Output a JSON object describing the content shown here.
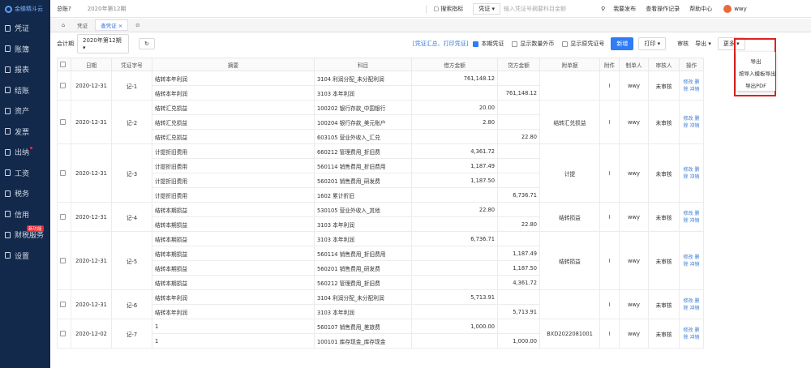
{
  "app": {
    "name": "金蝶精斗云"
  },
  "sidebar": {
    "items": [
      {
        "label": "凭证"
      },
      {
        "label": "账簿"
      },
      {
        "label": "报表"
      },
      {
        "label": "结账"
      },
      {
        "label": "资产"
      },
      {
        "label": "发票"
      },
      {
        "label": "出纳"
      },
      {
        "label": "工资"
      },
      {
        "label": "税务"
      },
      {
        "label": "信用"
      },
      {
        "label": "财税服务",
        "tag": "新功能"
      },
      {
        "label": "设置"
      }
    ]
  },
  "topbar": {
    "company": "总账?",
    "period": "2020年第12期",
    "search_label": "搜索指标",
    "type": "凭证",
    "search_placeholder": "输入凭证号摘要科目金额",
    "links": [
      "我要发布",
      "查看操作记录",
      "帮助中心"
    ],
    "user": "wwy"
  },
  "tabs": [
    "首页",
    "凭证",
    "查凭证"
  ],
  "toolbar": {
    "period_label": "会计期",
    "period_value": "2020年第12期",
    "summary_link": "[凭证汇总、打印凭证]",
    "check1": "本期凭证",
    "check2": "显示数量外币",
    "check3": "显示原凭证号",
    "add": "新增",
    "print": "打印",
    "more1": "审核",
    "export": "导出",
    "more": "更多"
  },
  "dropdown": [
    "导出",
    "按导入模板导出",
    "导出PDF"
  ],
  "headers": [
    "日期",
    "凭证字号",
    "摘要",
    "科目",
    "借方金额",
    "贷方金额",
    "附单据",
    "附件",
    "制单人",
    "审核人",
    "操作"
  ],
  "vouchers": [
    {
      "date": "2020-12-31",
      "no": "记-1",
      "attach": "",
      "maker": "wwy",
      "status": "未审核",
      "rows": [
        [
          "结转本年利润",
          "3104 利润分配_未分配利润",
          "761,148.12",
          ""
        ],
        [
          "结转本年利润",
          "3103 本年利润",
          "",
          "761,148.12"
        ]
      ]
    },
    {
      "date": "2020-12-31",
      "no": "记-2",
      "attach": "结转汇兑损益",
      "maker": "wwy",
      "status": "未审核",
      "rows": [
        [
          "结转汇兑损益",
          "100202 银行存款_中国银行",
          "20.00",
          ""
        ],
        [
          "结转汇兑损益",
          "100204 银行存款_美元账户",
          "2.80",
          ""
        ],
        [
          "结转汇兑损益",
          "603105 营业外收入_汇兑",
          "",
          "22.80"
        ]
      ]
    },
    {
      "date": "2020-12-31",
      "no": "记-3",
      "attach": "计提",
      "maker": "wwy",
      "status": "未审核",
      "rows": [
        [
          "计提折旧费用",
          "660212 管理费用_折旧费",
          "4,361.72",
          ""
        ],
        [
          "计提折旧费用",
          "560114 销售费用_折旧费用",
          "1,187.49",
          ""
        ],
        [
          "计提折旧费用",
          "560201 销售费用_研发费",
          "1,187.50",
          ""
        ],
        [
          "计提折旧费用",
          "1602 累计折旧",
          "",
          "6,736.71"
        ]
      ]
    },
    {
      "date": "2020-12-31",
      "no": "记-4",
      "attach": "结转损益",
      "maker": "wwy",
      "status": "未审核",
      "rows": [
        [
          "结转本期损益",
          "530105 营业外收入_其他",
          "22.80",
          ""
        ],
        [
          "结转本期损益",
          "3103 本年利润",
          "",
          "22.80"
        ]
      ]
    },
    {
      "date": "2020-12-31",
      "no": "记-5",
      "attach": "结转损益",
      "maker": "wwy",
      "status": "未审核",
      "rows": [
        [
          "结转本期损益",
          "3103 本年利润",
          "6,736.71",
          ""
        ],
        [
          "结转本期损益",
          "560114 销售费用_折旧费用",
          "",
          "1,187.49"
        ],
        [
          "结转本期损益",
          "560201 销售费用_研发费",
          "",
          "1,187.50"
        ],
        [
          "结转本期损益",
          "560212 管理费用_折旧费",
          "",
          "4,361.72"
        ]
      ]
    },
    {
      "date": "2020-12-31",
      "no": "记-6",
      "attach": "",
      "maker": "wwy",
      "status": "未审核",
      "rows": [
        [
          "结转本年利润",
          "3104 利润分配_未分配利润",
          "5,713.91",
          ""
        ],
        [
          "结转本年利润",
          "3103 本年利润",
          "",
          "5,713.91"
        ]
      ]
    },
    {
      "date": "2020-12-02",
      "no": "记-7",
      "attach": "BXD2022081001",
      "maker": "wwy",
      "status": "未审核",
      "rows": [
        [
          "1",
          "560107 销售费用_差旅费",
          "1,000.00",
          ""
        ],
        [
          "1",
          "100101 库存现金_库存现金",
          "",
          "1,000.00"
        ]
      ]
    }
  ],
  "ops": "修改 删除 冲销"
}
